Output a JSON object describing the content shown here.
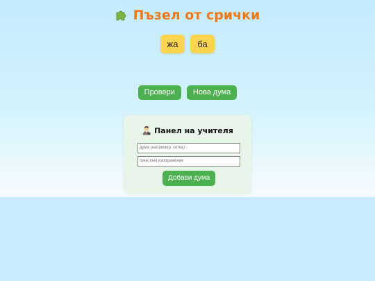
{
  "app": {
    "title": "Пъзел от срички",
    "title_icon": "puzzle-piece-icon",
    "accent_color": "#f07a1a"
  },
  "syllables": [
    {
      "text": "жа"
    },
    {
      "text": "ба"
    }
  ],
  "controls": {
    "check_label": "Провери",
    "new_word_label": "Нова дума",
    "button_color": "#4caf50"
  },
  "teacher_panel": {
    "title": "Панел на учителя",
    "title_icon": "teacher-icon",
    "word_input": {
      "value": "",
      "placeholder": "дума (например: котка)"
    },
    "image_input": {
      "value": "",
      "placeholder": "линк към изображение"
    },
    "add_label": "Добави дума"
  },
  "colors": {
    "syllable_tile": "#ffd54f",
    "panel_background": "#e8f5e9",
    "page_background": "#c9ecfc"
  }
}
